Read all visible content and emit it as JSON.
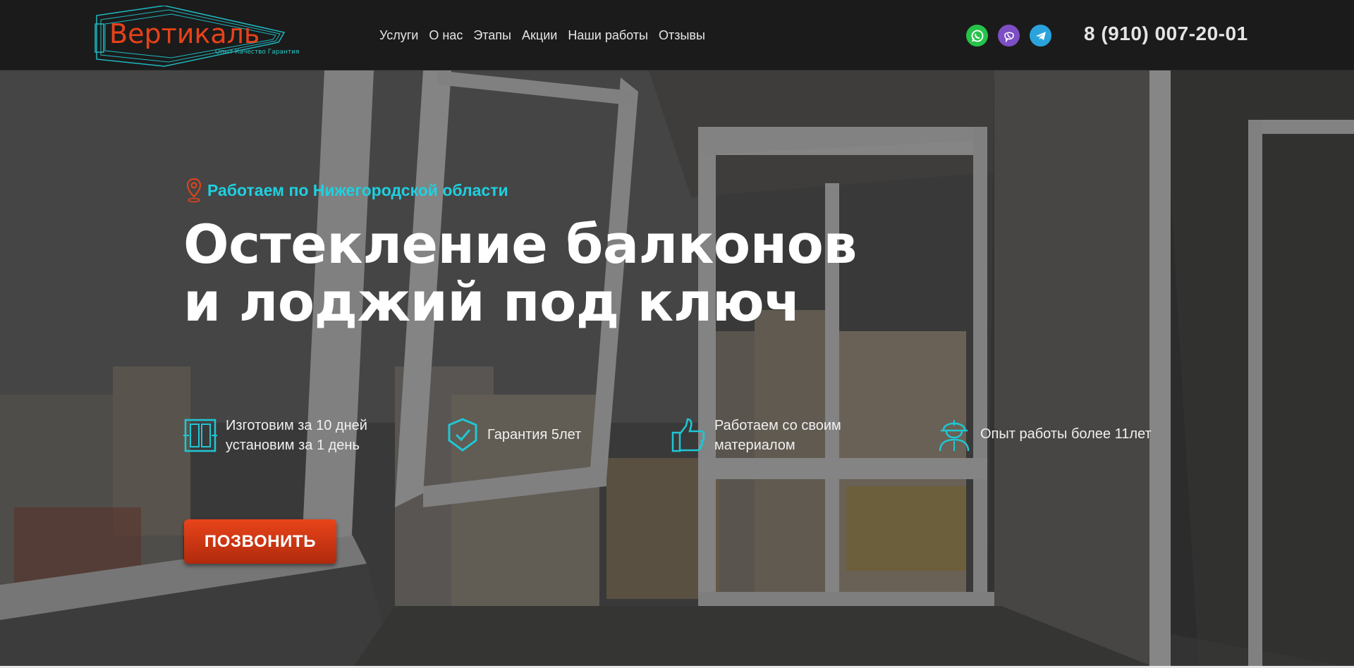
{
  "header": {
    "logo_text": "Вертикаль",
    "logo_tagline": "Опыт Качество Гарантия",
    "nav": [
      "Услуги",
      "О нас",
      "Этапы",
      "Акции",
      "Наши работы",
      "Отзывы"
    ],
    "messengers": [
      "whatsapp-icon",
      "viber-icon",
      "telegram-icon"
    ],
    "phone": "8 (910) 007-20-01"
  },
  "hero": {
    "location": "Работаем по Нижегородской области",
    "title_line1": "Остекление балконов",
    "title_line2": "и лоджий под ключ",
    "features": [
      {
        "icon": "window-frame-icon",
        "line1": "Изготовим за 10 дней",
        "line2": "установим за 1 день"
      },
      {
        "icon": "shield-check-icon",
        "line1": "Гарантия 5лет",
        "line2": ""
      },
      {
        "icon": "thumbs-up-icon",
        "line1": "Работаем со своим",
        "line2": "материалом"
      },
      {
        "icon": "worker-icon",
        "line1": "Опыт работы  более 11лет",
        "line2": ""
      }
    ],
    "cta_label": "ПОЗВОНИТЬ"
  },
  "colors": {
    "accent_orange": "#e8441a",
    "accent_cyan": "#1fd0e0",
    "header_bg": "#1a1a1a"
  }
}
